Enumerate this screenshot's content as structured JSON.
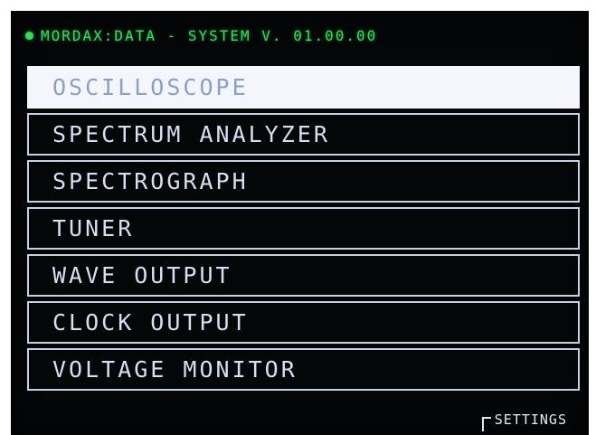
{
  "header": {
    "title": "MORDAX:DATA - SYSTEM V. 01.00.00",
    "status_icon": "dot-icon",
    "accent_color": "#2fe05a"
  },
  "menu": {
    "selected_index": 0,
    "items": [
      {
        "label": "OSCILLOSCOPE"
      },
      {
        "label": "SPECTRUM ANALYZER"
      },
      {
        "label": "SPECTROGRAPH"
      },
      {
        "label": "TUNER"
      },
      {
        "label": "WAVE OUTPUT"
      },
      {
        "label": "CLOCK OUTPUT"
      },
      {
        "label": "VOLTAGE MONITOR"
      }
    ]
  },
  "softkey": {
    "label": "SETTINGS",
    "icon": "bracket-icon"
  }
}
